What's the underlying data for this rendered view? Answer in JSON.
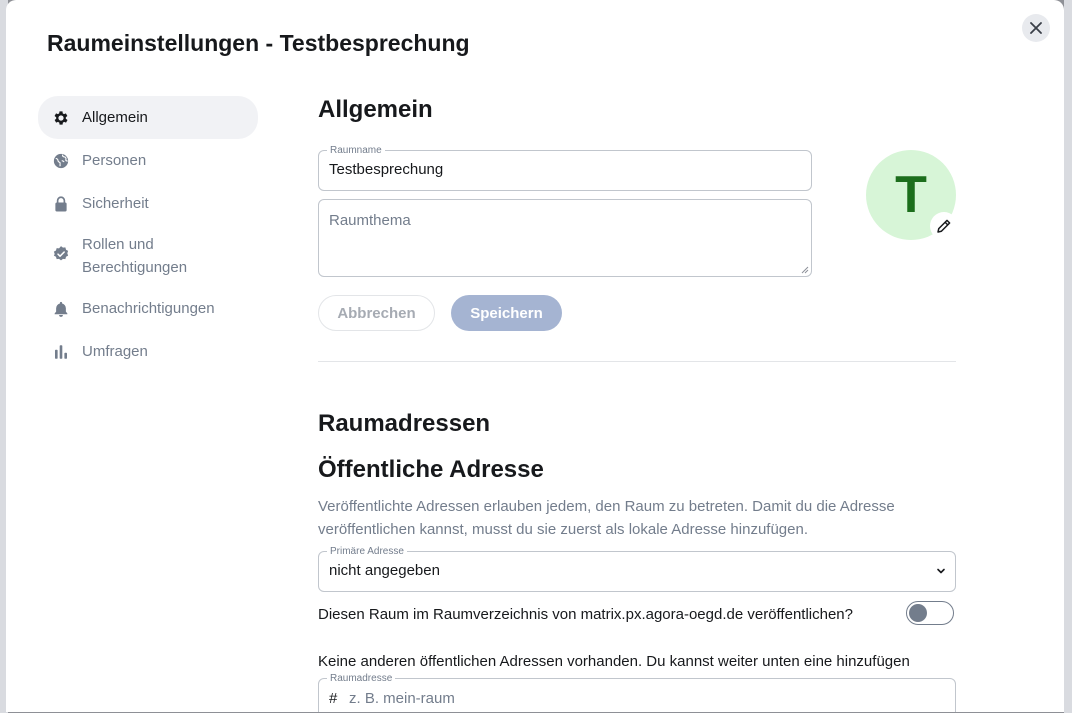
{
  "dialog": {
    "title": "Raumeinstellungen - Testbesprechung",
    "close_icon": "close-icon"
  },
  "sidebar": {
    "items": [
      {
        "label": "Allgemein",
        "icon": "gear-icon",
        "active": true
      },
      {
        "label": "Personen",
        "icon": "globe-icon"
      },
      {
        "label": "Sicherheit",
        "icon": "lock-icon"
      },
      {
        "label": "Rollen und Berechtigungen",
        "line1": "Rollen und",
        "line2": "Berechtigungen",
        "icon": "badge-check-icon"
      },
      {
        "label": "Benachrichtigungen",
        "icon": "bell-icon"
      },
      {
        "label": "Umfragen",
        "icon": "poll-chart-icon"
      }
    ]
  },
  "general": {
    "heading": "Allgemein",
    "room_name": {
      "label": "Raumname",
      "value": "Testbesprechung"
    },
    "room_topic": {
      "placeholder": "Raumthema",
      "value": ""
    },
    "avatar_letter": "T",
    "avatar_color": "#d7f5d7",
    "avatar_text_color": "#1c6e1c",
    "cancel_label": "Abbrechen",
    "save_label": "Speichern"
  },
  "addresses": {
    "heading": "Raumadressen",
    "public_heading": "Öffentliche Adresse",
    "public_description": "Veröffentlichte Adressen erlauben jedem, den Raum zu betreten. Damit du die Adresse veröffentlichen kannst, musst du sie zuerst als lokale Adresse hinzufügen.",
    "primary_address": {
      "label": "Primäre Adresse",
      "value": "nicht angegeben"
    },
    "publish_directory_label": "Diesen Raum im Raumverzeichnis von matrix.px.agora-oegd.de veröffentlichen?",
    "publish_directory_enabled": false,
    "no_public_addresses": "Keine anderen öffentlichen Adressen vorhanden. Du kannst weiter unten eine hinzufügen",
    "room_address": {
      "label": "Raumadresse",
      "prefix": "#",
      "placeholder": "z. B. mein-raum"
    }
  }
}
